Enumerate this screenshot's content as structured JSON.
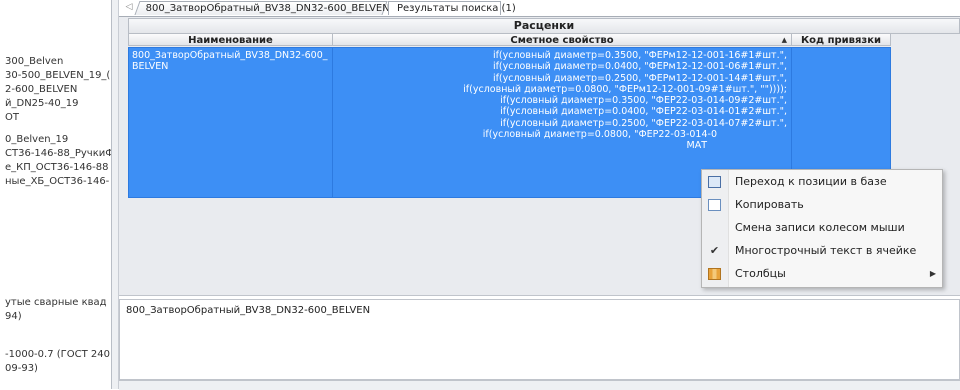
{
  "left_tree": {
    "items": [
      "300_Belven",
      "30-500_BELVEN_19_(",
      "2-600_BELVEN",
      "й_DN25-40_19",
      "ОТ",
      "0_Belven_19",
      "СТ36-146-88_РучкиФ",
      "е_КП_ОСТ36-146-88",
      "ные_ХБ_ОСТ36-146-",
      "утые сварные квад",
      "94)",
      "-1000-0.7 (ГОСТ 240",
      "09-93)"
    ]
  },
  "tabs": {
    "arrow": "◁",
    "items": [
      {
        "label": "800_ЗатворОбратный_BV38_DN32-600_BELVEN"
      },
      {
        "label": "Результаты поиска (1)"
      }
    ]
  },
  "grid": {
    "caption": "Расценки",
    "columns": [
      "Наименование",
      "Сметное свойство",
      "Код привязки"
    ],
    "row": {
      "name": "800_ЗатворОбратный_BV38_DN32-600_BELVEN",
      "property_lines": [
        "if(условный диаметр=0.3500, \"ФЕРм12-12-001-16#1#шт.\",",
        "if(условный диаметр=0.0400, \"ФЕРм12-12-001-06#1#шт.\",",
        "if(условный диаметр=0.2500, \"ФЕРм12-12-001-14#1#шт.\",",
        "if(условный диаметр=0.0800, \"ФЕРм12-12-001-09#1#шт.\", \"\"))));",
        "if(условный диаметр=0.3500, \"ФЕР22-03-014-09#2#шт.\",",
        "if(условный диаметр=0.0400, \"ФЕР22-03-014-01#2#шт.\",",
        "if(условный диаметр=0.2500, \"ФЕР22-03-014-07#2#шт.\",",
        "if(условный диаметр=0.0800, \"ФЕР22-03-014-0",
        "МАТ"
      ],
      "code": ""
    }
  },
  "detail": {
    "text": "800_ЗатворОбратный_BV38_DN32-600_BELVEN"
  },
  "context_menu": {
    "items": [
      {
        "label": "Переход к позиции в базе",
        "icon": "book-icon"
      },
      {
        "label": "Копировать",
        "icon": "copy-icon"
      },
      {
        "label": "Смена записи колесом мыши",
        "icon": ""
      },
      {
        "label": "Многострочный текст в ячейке",
        "icon": "check-icon",
        "checked": true
      },
      {
        "label": "Столбцы",
        "icon": "columns-icon",
        "submenu": true
      }
    ],
    "check_glyph": "✔",
    "submenu_glyph": "▶"
  },
  "colors": {
    "selection": "#3d8ff5",
    "grid_background": "#e9ebef"
  }
}
